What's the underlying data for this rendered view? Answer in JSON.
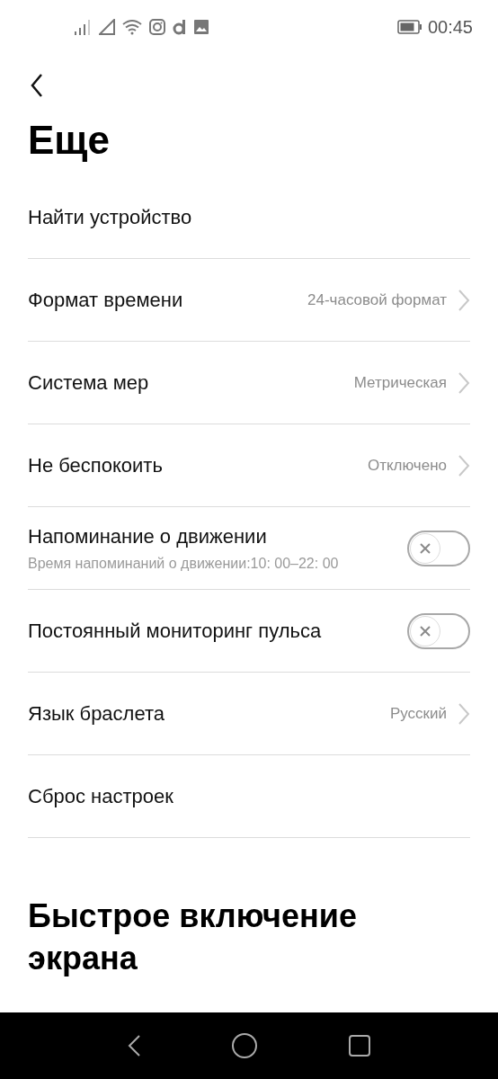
{
  "status_bar": {
    "time": "00:45"
  },
  "title": "Еще",
  "rows": [
    {
      "kind": "plain",
      "label": "Найти устройство"
    },
    {
      "kind": "value",
      "label": "Формат времени",
      "value": "24-часовой формат"
    },
    {
      "kind": "value",
      "label": "Система мер",
      "value": "Метрическая"
    },
    {
      "kind": "value",
      "label": "Не беспокоить",
      "value": "Отключено"
    },
    {
      "kind": "toggle",
      "label": "Напоминание о движении",
      "subtitle": "Время напоминаний о движении:10: 00–22: 00",
      "on": false
    },
    {
      "kind": "toggle",
      "label": "Постоянный мониторинг пульса",
      "on": false
    },
    {
      "kind": "value",
      "label": "Язык браслета",
      "value": "Русский"
    },
    {
      "kind": "plain",
      "label": "Сброс настроек"
    }
  ],
  "section_title": "Быстрое включение экрана"
}
